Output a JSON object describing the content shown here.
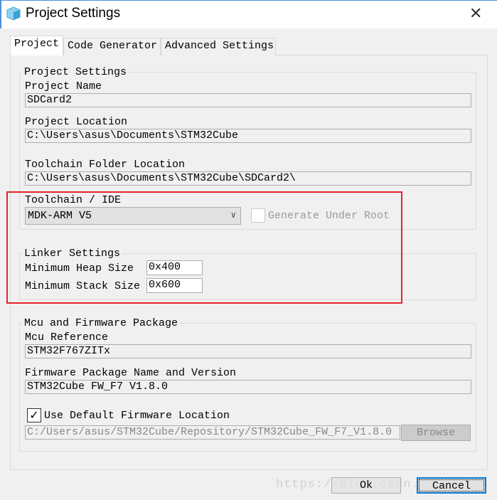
{
  "window": {
    "title": "Project Settings",
    "icon": "cube-icon",
    "close": "✕"
  },
  "tabs": [
    {
      "label": "Project",
      "active": true
    },
    {
      "label": "Code Generator"
    },
    {
      "label": "Advanced Settings"
    }
  ],
  "project_settings": {
    "legend": "Project Settings",
    "name_label": "Project Name",
    "name_value": "SDCard2",
    "location_label": "Project Location",
    "location_value": "C:\\Users\\asus\\Documents\\STM32Cube",
    "toolchain_folder_label": "Toolchain Folder Location",
    "toolchain_folder_value": "C:\\Users\\asus\\Documents\\STM32Cube\\SDCard2\\",
    "toolchain_label": "Toolchain / IDE",
    "toolchain_value": "MDK-ARM V5",
    "generate_under_root_label": "Generate Under Root",
    "generate_under_root_checked": false
  },
  "linker": {
    "legend": "Linker Settings",
    "heap_label": "Minimum Heap Size",
    "heap_value": "0x400",
    "stack_label": "Minimum Stack Size",
    "stack_value": "0x600"
  },
  "mcu": {
    "legend": "Mcu and Firmware Package",
    "ref_label": "Mcu Reference",
    "ref_value": "STM32F767ZITx",
    "fw_label": "Firmware Package Name and Version",
    "fw_value": "STM32Cube FW_F7 V1.8.0",
    "use_default_label": "Use Default Firmware Location",
    "use_default_checked": true,
    "fw_location_value": "C:/Users/asus/STM32Cube/Repository/STM32Cube_FW_F7_V1.8.0",
    "browse_label": "Browse"
  },
  "buttons": {
    "ok": "Ok",
    "cancel": "Cancel"
  },
  "watermark": "https://blog.csdn.net/",
  "colors": {
    "highlight": "#e8202a",
    "accent": "#0078d7"
  }
}
